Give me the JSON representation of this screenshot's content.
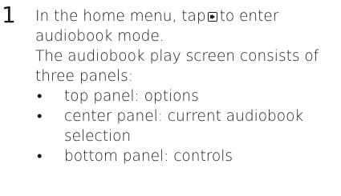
{
  "step": {
    "number": "1",
    "line1_before_icon": "In the home menu, tap",
    "line1_after_icon": "to enter",
    "icon": "audiobook-icon",
    "line2": "audiobook mode.",
    "line3": "The audiobook play screen consists of",
    "line4": "three panels:",
    "bullet_char": "•",
    "panels": [
      {
        "text": "top panel: options"
      },
      {
        "text": "center panel: current audiobook",
        "continuation": "selection"
      },
      {
        "text": "bottom panel: controls"
      }
    ]
  }
}
